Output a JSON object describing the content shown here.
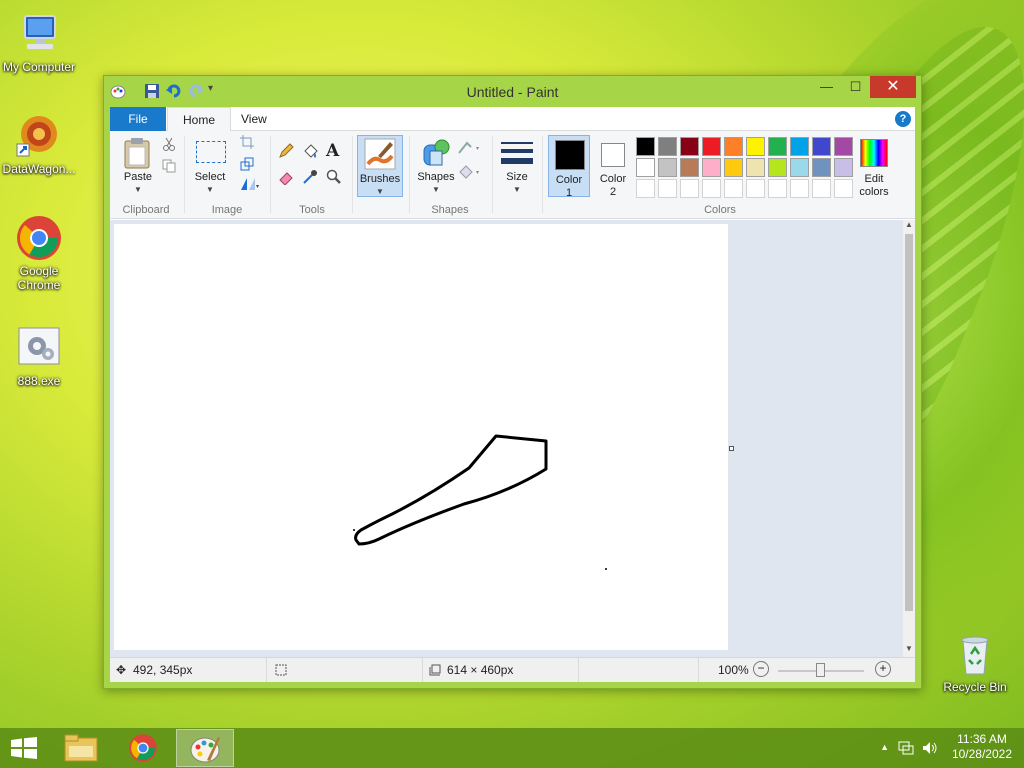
{
  "desktop": {
    "icons": [
      {
        "label": "My Computer",
        "icon": "computer-icon"
      },
      {
        "label": "DataWagon...",
        "icon": "datawagon-icon"
      },
      {
        "label": "Google Chrome",
        "icon": "chrome-icon"
      },
      {
        "label": "888.exe",
        "icon": "exe-icon"
      },
      {
        "label": "Recycle Bin",
        "icon": "recycle-bin-icon"
      }
    ]
  },
  "window": {
    "title": "Untitled - Paint",
    "controls": {
      "minimize": "—",
      "maximize": "☐",
      "close": "✕"
    }
  },
  "tabs": {
    "file": "File",
    "home": "Home",
    "view": "View"
  },
  "ribbon": {
    "clipboard": {
      "label": "Clipboard",
      "paste": "Paste"
    },
    "image": {
      "label": "Image",
      "select": "Select"
    },
    "tools": {
      "label": "Tools"
    },
    "brushes": {
      "label": "Brushes"
    },
    "shapes": {
      "label": "Shapes",
      "button": "Shapes"
    },
    "size": {
      "label": "Size"
    },
    "colors": {
      "label": "Colors",
      "color1": "Color\n1",
      "color1_line1": "Color",
      "color1_line2": "1",
      "color2_line1": "Color",
      "color2_line2": "2",
      "edit_line1": "Edit",
      "edit_line2": "colors",
      "color1_value": "#000000",
      "color2_value": "#ffffff",
      "palette_row1": [
        "#000000",
        "#7f7f7f",
        "#880015",
        "#ed1c24",
        "#ff7f27",
        "#fff200",
        "#22b14c",
        "#00a2e8",
        "#3f48cc",
        "#a349a4"
      ],
      "palette_row2": [
        "#ffffff",
        "#c3c3c3",
        "#b97a57",
        "#ffaec9",
        "#ffc90e",
        "#efe4b0",
        "#b5e61d",
        "#99d9ea",
        "#7092be",
        "#c8bfe7"
      ]
    }
  },
  "status": {
    "cursor": "492, 345px",
    "size": "614 × 460px",
    "zoom": "100%"
  },
  "taskbar": {
    "time": "11:36 AM",
    "date": "10/28/2022"
  }
}
